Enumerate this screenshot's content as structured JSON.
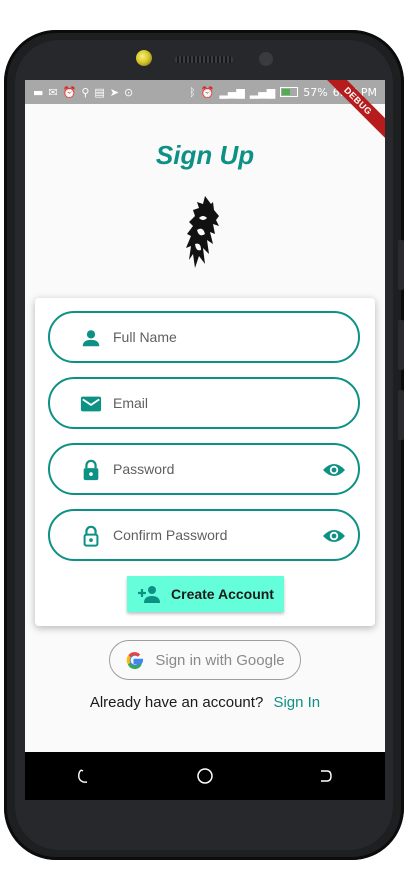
{
  "status_bar": {
    "battery": "57%",
    "time": "6:46 PM",
    "debug_banner": "DEBUG",
    "left_icons": [
      "chat-icon",
      "gmail-icon",
      "alarm-icon",
      "location-icon",
      "calendar-icon",
      "telegram-icon",
      "sync-icon"
    ],
    "right_icons": [
      "bluetooth-icon",
      "alarm-icon",
      "signal-icon",
      "signal-4g-icon",
      "battery-icon"
    ]
  },
  "page": {
    "title": "Sign Up"
  },
  "form": {
    "full_name_placeholder": "Full Name",
    "email_placeholder": "Email",
    "password_placeholder": "Password",
    "confirm_password_placeholder": "Confirm Password",
    "create_account_label": "Create Account"
  },
  "google": {
    "label": "Sign in with Google"
  },
  "footer": {
    "prompt": "Already have an account?",
    "link": "Sign In"
  },
  "colors": {
    "accent": "#0e9185",
    "button": "#64ffda",
    "status_bar": "#a8a8a8"
  },
  "nav_icons": [
    "recent-apps-icon",
    "home-icon",
    "back-icon"
  ]
}
